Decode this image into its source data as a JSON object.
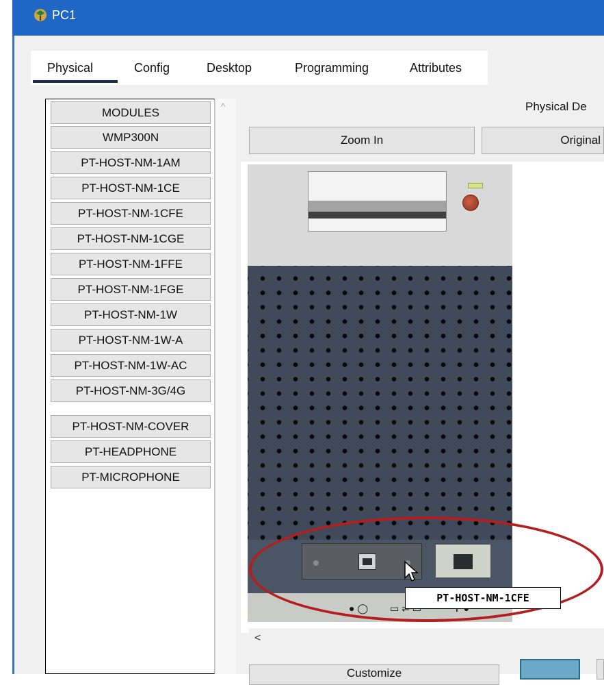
{
  "window": {
    "title": "PC1",
    "icon": "pc-device-icon"
  },
  "tabs": [
    {
      "label": "Physical",
      "active": true
    },
    {
      "label": "Config"
    },
    {
      "label": "Desktop"
    },
    {
      "label": "Programming"
    },
    {
      "label": "Attributes"
    }
  ],
  "modules": {
    "items": [
      "MODULES",
      "WMP300N",
      "PT-HOST-NM-1AM",
      "PT-HOST-NM-1CE",
      "PT-HOST-NM-1CFE",
      "PT-HOST-NM-1CGE",
      "PT-HOST-NM-1FFE",
      "PT-HOST-NM-1FGE",
      "PT-HOST-NM-1W",
      "PT-HOST-NM-1W-A",
      "PT-HOST-NM-1W-AC",
      "PT-HOST-NM-3G/4G",
      "PT-HOST-NM-COVER",
      "PT-HEADPHONE",
      "PT-MICROPHONE"
    ]
  },
  "physical": {
    "label": "Physical De",
    "zoom_in": "Zoom In",
    "original": "Original",
    "tooltip": "PT-HOST-NM-1CFE",
    "customize": "Customize",
    "scroll_left": "<"
  },
  "colors": {
    "titlebar": "#1f66c5",
    "annotation": "#b41e1e",
    "tower": "#404a5a"
  }
}
